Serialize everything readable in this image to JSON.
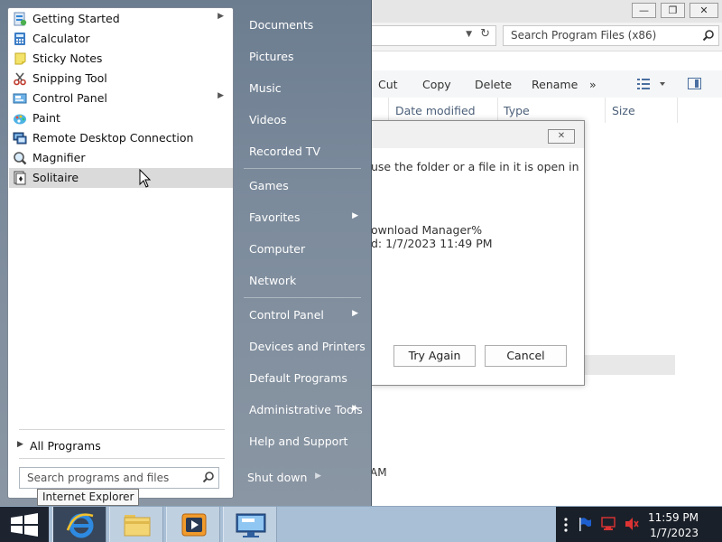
{
  "explorer": {
    "window_buttons": [
      "—",
      "❐",
      "✕"
    ],
    "search_placeholder": "Search Program Files (x86)",
    "toolbar": {
      "cut": "Cut",
      "copy": "Copy",
      "delete": "Delete",
      "rename": "Rename",
      "more": "»"
    },
    "columns": {
      "date_modified": "Date modified",
      "type": "Type",
      "size": "Size"
    },
    "partial_time_text": "AM"
  },
  "dialog": {
    "message": "use the folder or a file in it is open in",
    "item_name": "ownload Manager%",
    "item_date": "d: 1/7/2023 11:49 PM",
    "try_again": "Try Again",
    "cancel": "Cancel",
    "close_glyph": "✕"
  },
  "start_menu": {
    "programs": [
      {
        "label": "Getting Started",
        "icon": "getting-started-icon",
        "has_submenu": true
      },
      {
        "label": "Calculator",
        "icon": "calculator-icon",
        "has_submenu": false
      },
      {
        "label": "Sticky Notes",
        "icon": "sticky-notes-icon",
        "has_submenu": false
      },
      {
        "label": "Snipping Tool",
        "icon": "snipping-tool-icon",
        "has_submenu": false
      },
      {
        "label": "Control Panel",
        "icon": "control-panel-icon",
        "has_submenu": true
      },
      {
        "label": "Paint",
        "icon": "paint-icon",
        "has_submenu": false
      },
      {
        "label": "Remote Desktop Connection",
        "icon": "remote-desktop-icon",
        "has_submenu": false
      },
      {
        "label": "Magnifier",
        "icon": "magnifier-icon",
        "has_submenu": false
      },
      {
        "label": "Solitaire",
        "icon": "solitaire-icon",
        "has_submenu": false,
        "highlighted": true
      }
    ],
    "all_programs": "All Programs",
    "search_placeholder": "Search programs and files",
    "right_items": [
      {
        "label": "Documents"
      },
      {
        "label": "Pictures"
      },
      {
        "label": "Music"
      },
      {
        "label": "Videos"
      },
      {
        "label": "Recorded TV"
      },
      {
        "label": "Games"
      },
      {
        "label": "Favorites",
        "has_submenu": true
      },
      {
        "label": "Computer"
      },
      {
        "label": "Network"
      },
      {
        "label": "Control Panel",
        "has_submenu": true
      },
      {
        "label": "Devices and Printers"
      },
      {
        "label": "Default Programs"
      },
      {
        "label": "Administrative Tools",
        "has_submenu": true
      },
      {
        "label": "Help and Support"
      }
    ],
    "shutdown": "Shut down"
  },
  "tooltip": "Internet Explorer",
  "taskbar": {
    "buttons": [
      "start-button",
      "internet-explorer",
      "file-explorer",
      "media-player",
      "remote-desktop"
    ],
    "tray_icons": [
      "show-hidden-icons",
      "action-center-flag-icon",
      "network-icon",
      "volume-icon"
    ],
    "time": "11:59 PM",
    "date": "1/7/2023"
  },
  "colors": {
    "start_menu_right": "#7a899a",
    "taskbar": "#a9bfd6",
    "tray": "#1a2029",
    "highlight": "#dadada"
  }
}
